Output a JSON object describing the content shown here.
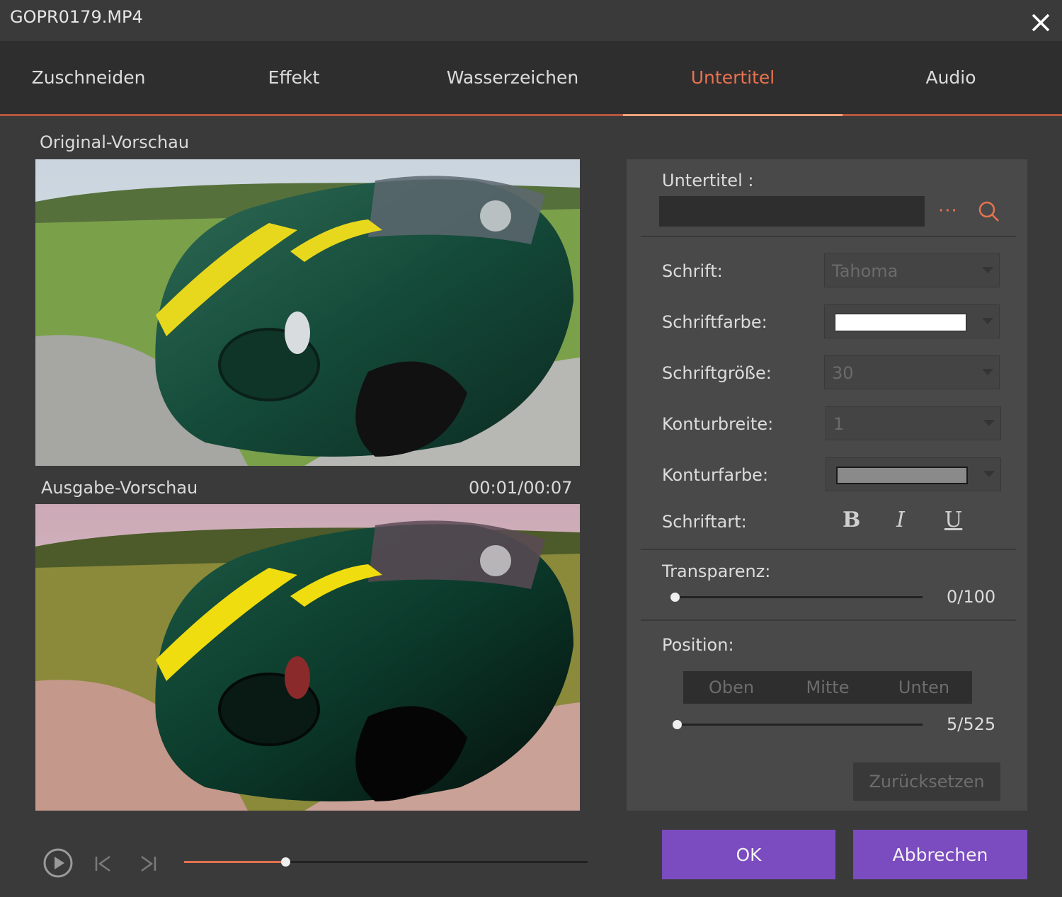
{
  "window": {
    "title": "GOPR0179.MP4",
    "close_icon": "close-icon"
  },
  "tabs": [
    {
      "label": "Zuschneiden"
    },
    {
      "label": "Effekt"
    },
    {
      "label": "Wasserzeichen"
    },
    {
      "label": "Untertitel",
      "active": true
    },
    {
      "label": "Audio"
    }
  ],
  "preview": {
    "original_label": "Original-Vorschau",
    "output_label": "Ausgabe-Vorschau",
    "time": "00:01/00:07"
  },
  "player": {
    "play_icon": "play-icon",
    "prev_icon": "skip-back-icon",
    "next_icon": "skip-forward-icon",
    "progress": 0.25
  },
  "subtitle": {
    "label": "Untertitel :",
    "value": "",
    "more_label": "···"
  },
  "settings": {
    "font_label": "Schrift:",
    "font_value": "Tahoma",
    "font_color_label": "Schriftfarbe:",
    "font_color": "#ffffff",
    "font_size_label": "Schriftgröße:",
    "font_size_value": "30",
    "outline_width_label": "Konturbreite:",
    "outline_width_value": "1",
    "outline_color_label": "Konturfarbe:",
    "outline_color": "#8a8a8a",
    "font_style_label": "Schriftart:",
    "bold": "B",
    "italic": "I",
    "underline": "U"
  },
  "transparency": {
    "label": "Transparenz:",
    "value_text": "0/100",
    "value": 0,
    "max": 100
  },
  "position": {
    "label": "Position:",
    "options": [
      "Oben",
      "Mitte",
      "Unten"
    ],
    "value_text": "5/525",
    "value": 5,
    "max": 525
  },
  "buttons": {
    "reset": "Zurücksetzen",
    "ok": "OK",
    "cancel": "Abbrechen"
  },
  "colors": {
    "accent": "#e8734f",
    "primary_button": "#7b4bc0"
  }
}
